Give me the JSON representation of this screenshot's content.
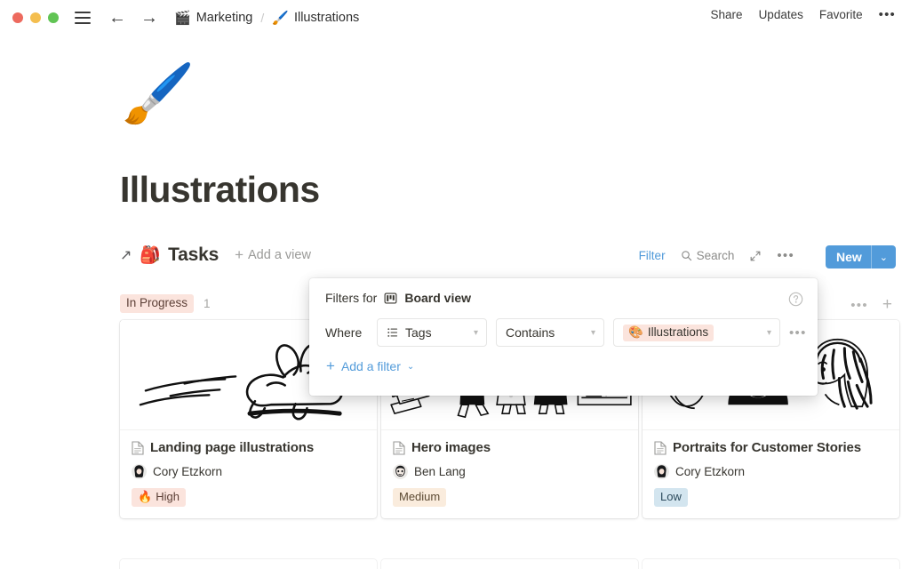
{
  "window": {
    "traffic_lights": [
      "close",
      "minimize",
      "zoom"
    ],
    "menu_icon": "hamburger-icon",
    "back_icon": "←",
    "forward_icon": "→",
    "breadcrumb": [
      {
        "emoji": "🎬",
        "label": "Marketing"
      },
      {
        "emoji": "🖌️",
        "label": "Illustrations"
      }
    ],
    "separator": "/",
    "actions": [
      {
        "label": "Share"
      },
      {
        "label": "Updates"
      },
      {
        "label": "Favorite"
      }
    ],
    "more_label": "•••"
  },
  "page": {
    "emoji": "🖌️",
    "title": "Illustrations"
  },
  "database": {
    "open_arrow": "↗",
    "emoji": "🎒",
    "title": "Tasks",
    "add_view_label": "Add a view",
    "add_view_plus": "+",
    "toolbar": {
      "filter_label": "Filter",
      "search_label": "Search",
      "expand_icon": "⤢",
      "more_label": "•••",
      "new_label": "New",
      "new_chevron": "⌄"
    }
  },
  "board": {
    "column": {
      "status": "In Progress",
      "count": "1",
      "more_label": "•••",
      "add_label": "+"
    },
    "cards": [
      {
        "title": "Landing page illustrations",
        "person": "Cory Etzkorn",
        "priority": "High",
        "priority_emoji": "🔥",
        "priority_class": "tag-high",
        "cover": "rabbit-line-art"
      },
      {
        "title": "Hero images",
        "person": "Ben Lang",
        "priority": "Medium",
        "priority_emoji": "",
        "priority_class": "tag-medium",
        "cover": "people-documents-line-art"
      },
      {
        "title": "Portraits for Customer Stories",
        "person": "Cory Etzkorn",
        "priority": "Low",
        "priority_emoji": "",
        "priority_class": "tag-low",
        "cover": "portraits-line-art"
      }
    ]
  },
  "filter_popover": {
    "heading_label": "Filters for",
    "view_icon": "board-view-icon",
    "view_name": "Board view",
    "help_icon": "help-circle-icon",
    "where_label": "Where",
    "property": {
      "icon": "multi-select-icon",
      "value": "Tags"
    },
    "operator": {
      "value": "Contains"
    },
    "value": {
      "emoji": "🎨",
      "value": "Illustrations"
    },
    "row_more_label": "•••",
    "add_filter_label": "Add a filter",
    "add_filter_plus": "+",
    "add_filter_chevron": "⌄"
  },
  "colors": {
    "accent_blue": "#529bda",
    "tag_peach": "#fbe4dd",
    "tag_cream": "#faecdd",
    "tag_blue": "#d3e5ef",
    "text": "#37352f"
  }
}
